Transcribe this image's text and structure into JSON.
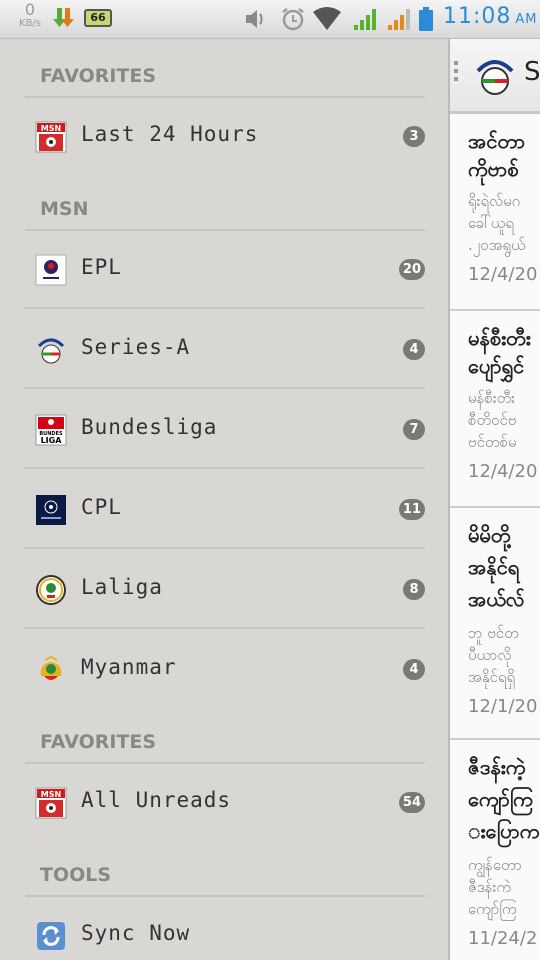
{
  "status_bar": {
    "net_speed": "0",
    "net_unit": "KB/s",
    "battery_percent": "66",
    "clock": "11:08",
    "ampm": "AM"
  },
  "drawer": {
    "sections": [
      {
        "title": "FAVORITES",
        "items": [
          {
            "label": "Last 24 Hours",
            "count": "3",
            "icon": "msn-icon"
          }
        ]
      },
      {
        "title": "MSN",
        "items": [
          {
            "label": "EPL",
            "count": "20",
            "icon": "premier-league-icon"
          },
          {
            "label": "Series-A",
            "count": "4",
            "icon": "lega-calcio-icon"
          },
          {
            "label": "Bundesliga",
            "count": "7",
            "icon": "bundesliga-icon"
          },
          {
            "label": "CPL",
            "count": "11",
            "icon": "champions-league-icon"
          },
          {
            "label": "Laliga",
            "count": "8",
            "icon": "laliga-icon"
          },
          {
            "label": "Myanmar",
            "count": "4",
            "icon": "myanmar-emblem-icon"
          }
        ]
      },
      {
        "title": "FAVORITES",
        "items": [
          {
            "label": "All Unreads",
            "count": "54",
            "icon": "msn-icon"
          }
        ]
      },
      {
        "title": "TOOLS",
        "items": [
          {
            "label": "Sync Now",
            "icon": "sync-icon"
          }
        ]
      }
    ]
  },
  "content": {
    "title": "Se",
    "articles": [
      {
        "title1": "အင်တာ",
        "title2": "ကိုဗာစ်",
        "snippet1": "ရိုးရဲလ်မဂ",
        "snippet2": "ခေါ်ယူရ",
        "snippet3": ".၂၀အရွယ်",
        "date": "12/4/20"
      },
      {
        "title1": "မန်စီးတီး",
        "title2": "ပျော်ရွှင်",
        "snippet1": "မန်စီးတီး",
        "snippet2": "စီတိဝင်ဗ",
        "snippet3": "ဗင်တစ်မ",
        "date": "12/4/20"
      },
      {
        "title1": "မိမိတို့",
        "title2": "အနိုင်ရ",
        "title3": "အယ်လ်",
        "snippet1": "ဘူ ဗင်တ",
        "snippet2": "ပီယာလို",
        "snippet3": "အနိုင်ရရှိ",
        "date": "12/1/20"
      },
      {
        "title1": "ဇီဒန်းကဲ့",
        "title2": "ကျော်ကြ",
        "title3": "းပြောက",
        "snippet1": "ကျွန်တော",
        "snippet2": "ဇီဒန်းကဲ",
        "snippet3": "ကျော်ကြ",
        "date": "11/24/2"
      }
    ]
  },
  "colors": {
    "drawer_bg": "#d9d7d3",
    "badge_bg": "#7b7975",
    "clock": "#2a8bd8",
    "section_text": "#8a8884"
  }
}
